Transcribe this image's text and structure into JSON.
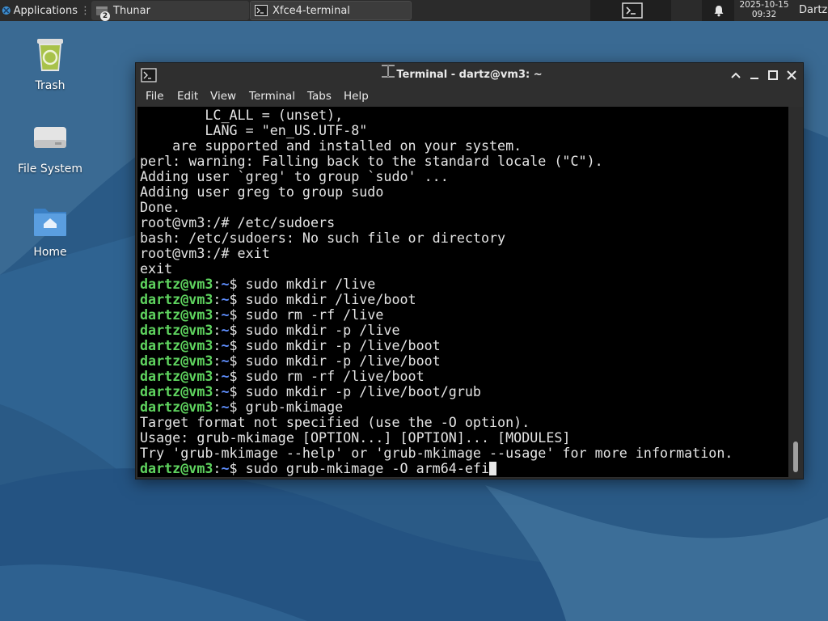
{
  "panel": {
    "apps_label": "Applications",
    "tasks": [
      {
        "label": "Thunar",
        "count": "2"
      },
      {
        "label": "Xfce4-terminal"
      }
    ],
    "clock_date": "2025-10-15",
    "clock_time": "09:32",
    "user": "Dartz",
    "icons": [
      "xfce-logo-icon",
      "folder-icon",
      "terminal-icon",
      "bell-icon"
    ]
  },
  "desktop": {
    "icons": [
      {
        "label": "Trash",
        "icon": "trash-icon"
      },
      {
        "label": "File System",
        "icon": "drive-icon"
      },
      {
        "label": "Home",
        "icon": "home-folder-icon"
      }
    ]
  },
  "window": {
    "title": "Terminal - dartz@vm3: ~",
    "menu": [
      "File",
      "Edit",
      "View",
      "Terminal",
      "Tabs",
      "Help"
    ],
    "colors": {
      "prompt_user": "#5fd45f",
      "prompt_path": "#5f8fff",
      "text": "#e4e4e4",
      "background": "#000000"
    }
  },
  "terminal": {
    "prompt_user": "dartz@vm3",
    "prompt_sep": ":",
    "prompt_path": "~",
    "prompt_sym": "$ ",
    "lines": [
      {
        "text": "        LC_ALL = (unset),"
      },
      {
        "text": "        LANG = \"en_US.UTF-8\""
      },
      {
        "text": "    are supported and installed on your system."
      },
      {
        "text": "perl: warning: Falling back to the standard locale (\"C\")."
      },
      {
        "text": "Adding user `greg' to group `sudo' ..."
      },
      {
        "text": "Adding user greg to group sudo"
      },
      {
        "text": "Done."
      },
      {
        "text": "root@vm3:/# /etc/sudoers"
      },
      {
        "text": "bash: /etc/sudoers: No such file or directory"
      },
      {
        "text": "root@vm3:/# exit"
      },
      {
        "text": "exit"
      },
      {
        "prompt": true,
        "cmd": "sudo mkdir /live"
      },
      {
        "prompt": true,
        "cmd": "sudo mkdir /live/boot"
      },
      {
        "prompt": true,
        "cmd": "sudo rm -rf /live"
      },
      {
        "prompt": true,
        "cmd": "sudo mkdir -p /live"
      },
      {
        "prompt": true,
        "cmd": "sudo mkdir -p /live/boot"
      },
      {
        "prompt": true,
        "cmd": "sudo mkdir -p /live/boot"
      },
      {
        "prompt": true,
        "cmd": "sudo rm -rf /live/boot"
      },
      {
        "prompt": true,
        "cmd": "sudo mkdir -p /live/boot/grub"
      },
      {
        "prompt": true,
        "cmd": "grub-mkimage"
      },
      {
        "text": "Target format not specified (use the -O option)."
      },
      {
        "text": "Usage: grub-mkimage [OPTION...] [OPTION]... [MODULES]"
      },
      {
        "text": "Try 'grub-mkimage --help' or 'grub-mkimage --usage' for more information."
      },
      {
        "prompt": true,
        "cmd": "sudo grub-mkimage -O arm64-efi",
        "cursor": true
      }
    ]
  }
}
